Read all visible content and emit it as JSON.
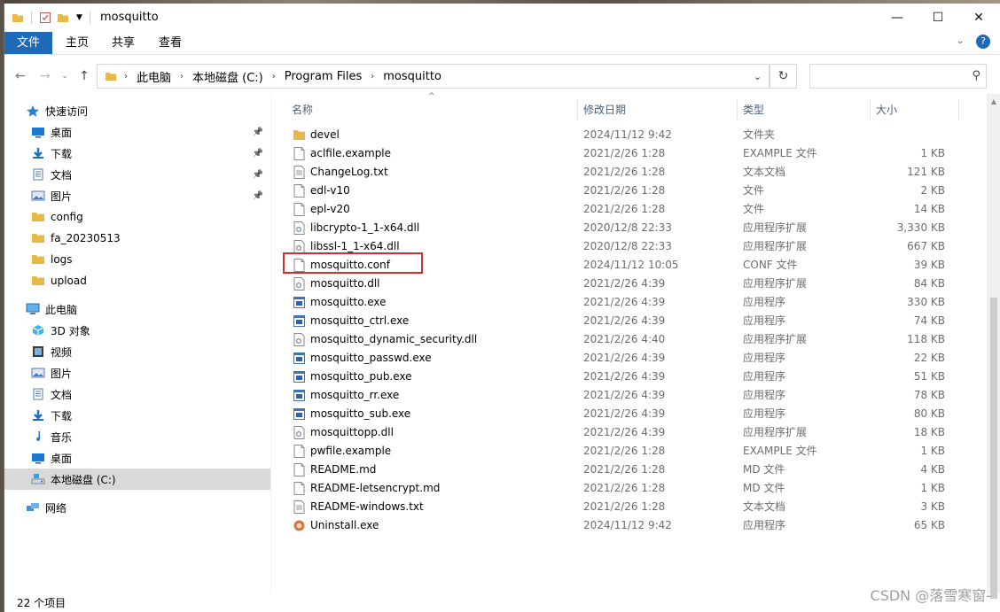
{
  "window": {
    "title": "mosquitto",
    "controls": {
      "minimize": "—",
      "maximize": "☐",
      "close": "✕"
    }
  },
  "ribbon": {
    "tabs": [
      "文件",
      "主页",
      "共享",
      "查看"
    ],
    "help": "?"
  },
  "address": {
    "crumbs": [
      "此电脑",
      "本地磁盘 (C:)",
      "Program Files",
      "mosquitto"
    ],
    "search_placeholder": ""
  },
  "nav_pane": {
    "items": [
      {
        "label": "快速访问",
        "icon": "star-icon",
        "level": 0,
        "pinned": false
      },
      {
        "label": "桌面",
        "icon": "desktop-icon",
        "level": 1,
        "pinned": true
      },
      {
        "label": "下载",
        "icon": "download-icon",
        "level": 1,
        "pinned": true
      },
      {
        "label": "文档",
        "icon": "document-icon",
        "level": 1,
        "pinned": true
      },
      {
        "label": "图片",
        "icon": "picture-icon",
        "level": 1,
        "pinned": true
      },
      {
        "label": "config",
        "icon": "folder-icon",
        "level": 1,
        "pinned": false
      },
      {
        "label": "fa_20230513",
        "icon": "folder-icon",
        "level": 1,
        "pinned": false
      },
      {
        "label": "logs",
        "icon": "folder-icon",
        "level": 1,
        "pinned": false
      },
      {
        "label": "upload",
        "icon": "folder-icon",
        "level": 1,
        "pinned": false
      },
      {
        "label": "此电脑",
        "icon": "computer-icon",
        "level": 0,
        "pinned": false
      },
      {
        "label": "3D 对象",
        "icon": "3d-objects-icon",
        "level": 1,
        "pinned": false
      },
      {
        "label": "视频",
        "icon": "video-icon",
        "level": 1,
        "pinned": false
      },
      {
        "label": "图片",
        "icon": "picture-icon",
        "level": 1,
        "pinned": false
      },
      {
        "label": "文档",
        "icon": "document-icon",
        "level": 1,
        "pinned": false
      },
      {
        "label": "下载",
        "icon": "download-icon",
        "level": 1,
        "pinned": false
      },
      {
        "label": "音乐",
        "icon": "music-icon",
        "level": 1,
        "pinned": false
      },
      {
        "label": "桌面",
        "icon": "desktop-icon",
        "level": 1,
        "pinned": false
      },
      {
        "label": "本地磁盘 (C:)",
        "icon": "drive-icon",
        "level": 1,
        "pinned": false,
        "selected": true
      },
      {
        "label": "网络",
        "icon": "network-icon",
        "level": 0,
        "pinned": false
      }
    ]
  },
  "columns": {
    "name": "名称",
    "date": "修改日期",
    "type": "类型",
    "size": "大小"
  },
  "files": [
    {
      "name": "devel",
      "date": "2024/11/12 9:42",
      "type": "文件夹",
      "size": "",
      "icon": "folder-icon"
    },
    {
      "name": "aclfile.example",
      "date": "2021/2/26 1:28",
      "type": "EXAMPLE 文件",
      "size": "1 KB",
      "icon": "file-icon"
    },
    {
      "name": "ChangeLog.txt",
      "date": "2021/2/26 1:28",
      "type": "文本文档",
      "size": "121 KB",
      "icon": "text-file-icon"
    },
    {
      "name": "edl-v10",
      "date": "2021/2/26 1:28",
      "type": "文件",
      "size": "2 KB",
      "icon": "file-icon"
    },
    {
      "name": "epl-v20",
      "date": "2021/2/26 1:28",
      "type": "文件",
      "size": "14 KB",
      "icon": "file-icon"
    },
    {
      "name": "libcrypto-1_1-x64.dll",
      "date": "2020/12/8 22:33",
      "type": "应用程序扩展",
      "size": "3,330 KB",
      "icon": "dll-icon"
    },
    {
      "name": "libssl-1_1-x64.dll",
      "date": "2020/12/8 22:33",
      "type": "应用程序扩展",
      "size": "667 KB",
      "icon": "dll-icon"
    },
    {
      "name": "mosquitto.conf",
      "date": "2024/11/12 10:05",
      "type": "CONF 文件",
      "size": "39 KB",
      "icon": "file-icon"
    },
    {
      "name": "mosquitto.dll",
      "date": "2021/2/26 4:39",
      "type": "应用程序扩展",
      "size": "84 KB",
      "icon": "dll-icon"
    },
    {
      "name": "mosquitto.exe",
      "date": "2021/2/26 4:39",
      "type": "应用程序",
      "size": "330 KB",
      "icon": "exe-icon"
    },
    {
      "name": "mosquitto_ctrl.exe",
      "date": "2021/2/26 4:39",
      "type": "应用程序",
      "size": "74 KB",
      "icon": "exe-icon"
    },
    {
      "name": "mosquitto_dynamic_security.dll",
      "date": "2021/2/26 4:40",
      "type": "应用程序扩展",
      "size": "118 KB",
      "icon": "dll-icon"
    },
    {
      "name": "mosquitto_passwd.exe",
      "date": "2021/2/26 4:39",
      "type": "应用程序",
      "size": "22 KB",
      "icon": "exe-icon"
    },
    {
      "name": "mosquitto_pub.exe",
      "date": "2021/2/26 4:39",
      "type": "应用程序",
      "size": "51 KB",
      "icon": "exe-icon"
    },
    {
      "name": "mosquitto_rr.exe",
      "date": "2021/2/26 4:39",
      "type": "应用程序",
      "size": "78 KB",
      "icon": "exe-icon"
    },
    {
      "name": "mosquitto_sub.exe",
      "date": "2021/2/26 4:39",
      "type": "应用程序",
      "size": "80 KB",
      "icon": "exe-icon"
    },
    {
      "name": "mosquittopp.dll",
      "date": "2021/2/26 4:39",
      "type": "应用程序扩展",
      "size": "18 KB",
      "icon": "dll-icon"
    },
    {
      "name": "pwfile.example",
      "date": "2021/2/26 1:28",
      "type": "EXAMPLE 文件",
      "size": "1 KB",
      "icon": "file-icon"
    },
    {
      "name": "README.md",
      "date": "2021/2/26 1:28",
      "type": "MD 文件",
      "size": "4 KB",
      "icon": "file-icon"
    },
    {
      "name": "README-letsencrypt.md",
      "date": "2021/2/26 1:28",
      "type": "MD 文件",
      "size": "1 KB",
      "icon": "file-icon"
    },
    {
      "name": "README-windows.txt",
      "date": "2021/2/26 1:28",
      "type": "文本文档",
      "size": "3 KB",
      "icon": "text-file-icon"
    },
    {
      "name": "Uninstall.exe",
      "date": "2024/11/12 9:42",
      "type": "应用程序",
      "size": "65 KB",
      "icon": "uninstall-icon"
    }
  ],
  "highlighted_file": "mosquitto.conf",
  "status": {
    "item_count": "22 个项目"
  },
  "watermark": "CSDN @落雪寒窗-",
  "colors": {
    "accent": "#1e6ab8",
    "highlight_border": "#d32f2f",
    "folder": "#e8b84a",
    "header_text": "#4c607a"
  }
}
